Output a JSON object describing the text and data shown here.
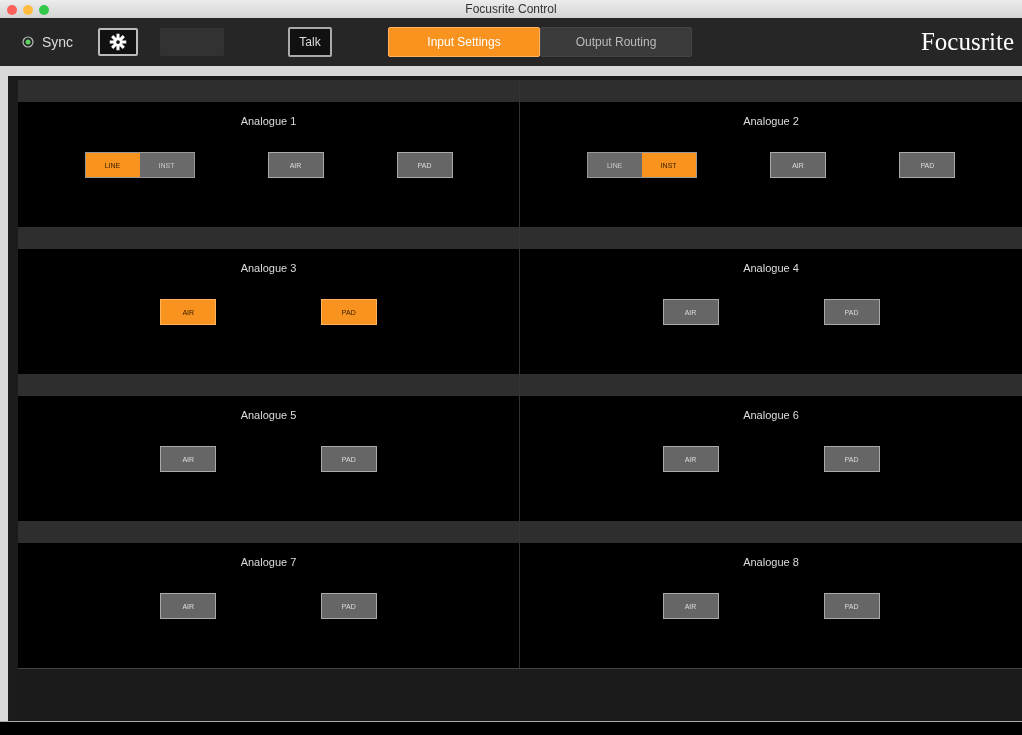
{
  "window": {
    "title": "Focusrite Control"
  },
  "toolbar": {
    "sync": {
      "label": "Sync",
      "on": true
    },
    "dim_disabled": true,
    "talk": "Talk",
    "tabs": [
      {
        "label": "Input Settings",
        "selected": true
      },
      {
        "label": "Output Routing",
        "selected": false
      }
    ],
    "logo": "Focusrite"
  },
  "channels": [
    {
      "name": "Analogue 1",
      "input_mode": [
        {
          "label": "LINE",
          "selected": true
        },
        {
          "label": "INST",
          "selected": false
        }
      ],
      "air": {
        "label": "AIR",
        "on": false
      },
      "pad": {
        "label": "PAD",
        "on": false
      }
    },
    {
      "name": "Analogue 2",
      "input_mode": [
        {
          "label": "LINE",
          "selected": false
        },
        {
          "label": "INST",
          "selected": true
        }
      ],
      "air": {
        "label": "AIR",
        "on": false
      },
      "pad": {
        "label": "PAD",
        "on": false
      }
    },
    {
      "name": "Analogue 3",
      "air": {
        "label": "AIR",
        "on": true
      },
      "pad": {
        "label": "PAD",
        "on": true
      }
    },
    {
      "name": "Analogue 4",
      "air": {
        "label": "AIR",
        "on": false
      },
      "pad": {
        "label": "PAD",
        "on": false
      }
    },
    {
      "name": "Analogue 5",
      "air": {
        "label": "AIR",
        "on": false
      },
      "pad": {
        "label": "PAD",
        "on": false
      }
    },
    {
      "name": "Analogue 6",
      "air": {
        "label": "AIR",
        "on": false
      },
      "pad": {
        "label": "PAD",
        "on": false
      }
    },
    {
      "name": "Analogue 7",
      "air": {
        "label": "AIR",
        "on": false
      },
      "pad": {
        "label": "PAD",
        "on": false
      }
    },
    {
      "name": "Analogue 8",
      "air": {
        "label": "AIR",
        "on": false
      },
      "pad": {
        "label": "PAD",
        "on": false
      }
    }
  ]
}
